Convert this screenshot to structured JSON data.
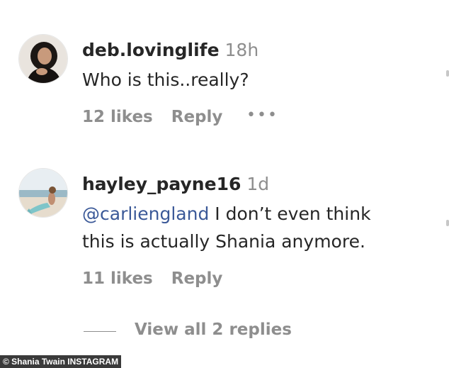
{
  "comments": [
    {
      "username": "deb.lovinglife",
      "time": "18h",
      "text": "Who is this..really?",
      "likes": "12 likes",
      "reply_label": "Reply",
      "more_glyph": "•••",
      "avatar_icon": "user-avatar-dark-hair"
    },
    {
      "username": "hayley_payne16",
      "time": "1d",
      "mention": "@carliengland",
      "text_line1_rest": " I don’t even think",
      "text_line2": "this is actually Shania anymore.",
      "likes": "11 likes",
      "reply_label": "Reply",
      "avatar_icon": "user-avatar-beach-mermaid"
    }
  ],
  "view_replies": "View all 2 replies",
  "credit": "© Shania Twain INSTAGRAM",
  "colors": {
    "text": "#262626",
    "secondary": "#8e8e8e",
    "mention": "#3b5998"
  }
}
